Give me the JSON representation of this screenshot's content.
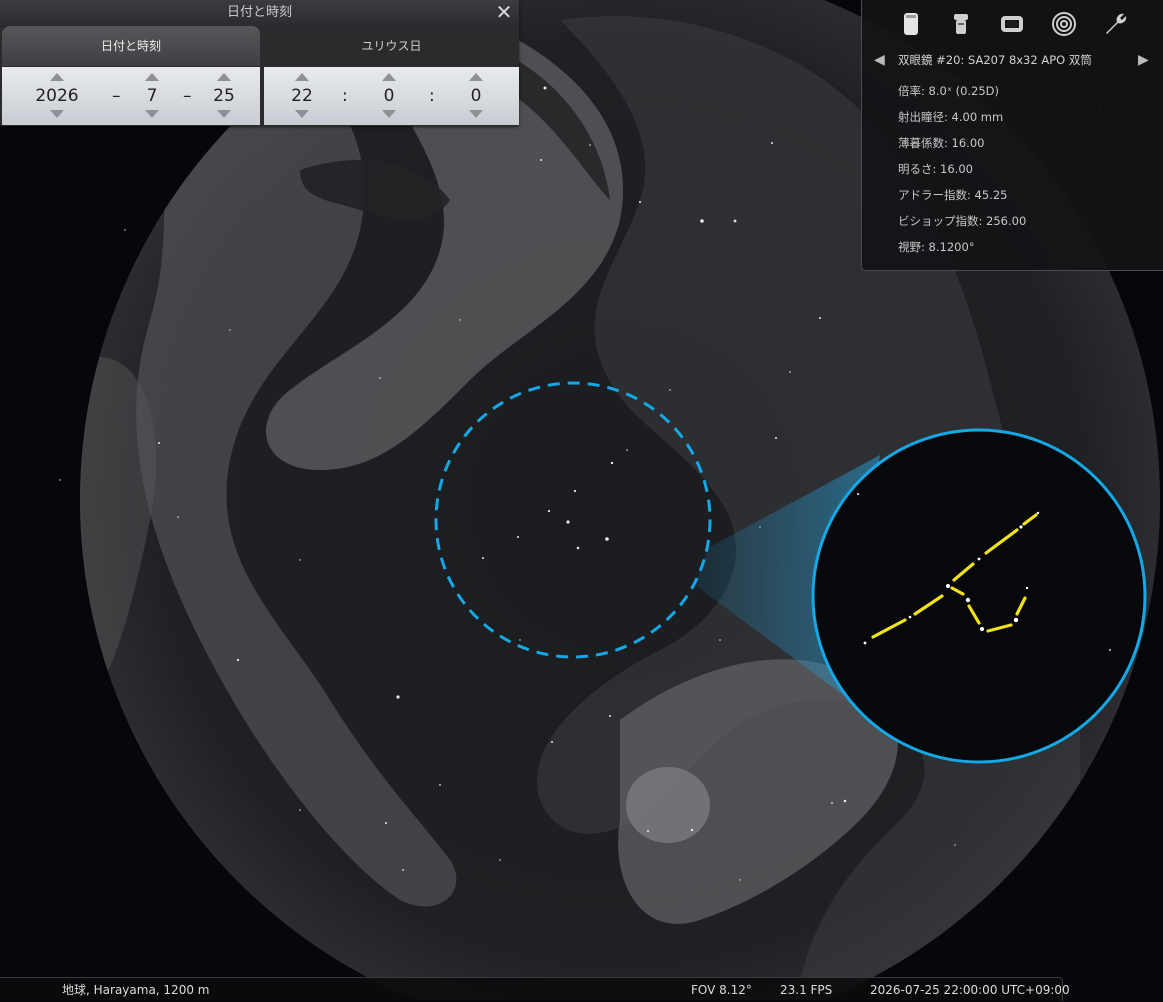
{
  "datetime_dialog": {
    "title": "日付と時刻",
    "close_symbol": "✕",
    "tabs": [
      {
        "label": "日付と時刻",
        "active": true
      },
      {
        "label": "ユリウス日",
        "active": false
      }
    ],
    "date": {
      "year": "2026",
      "month": "7",
      "day": "25",
      "separator": "–"
    },
    "time": {
      "hour": "22",
      "minute": "0",
      "second": "0",
      "separator": ":"
    }
  },
  "oculars_panel": {
    "icons": [
      "ocular-icon",
      "eyepiece-icon",
      "ccd-sensor-icon",
      "telrad-icon",
      "settings-wrench-icon"
    ],
    "prev_symbol": "◀",
    "next_symbol": "▶",
    "binocular_title": "双眼鏡 #20: SA207 8x32 APO 双筒",
    "rows": [
      "倍率: 8.0ˣ (0.25D)",
      "射出瞳径: 4.00 mm",
      "薄暮係数: 16.00",
      "明るさ: 16.00",
      "アドラー指数: 45.25",
      "ビショップ指数: 256.00",
      "視野: 8.1200°"
    ]
  },
  "status_bar": {
    "location": "地球, Harayama, 1200 m",
    "fov": "FOV 8.12°",
    "fps": "23.1 FPS",
    "datetime": "2026-07-25 22:00:00 UTC+09:00"
  },
  "colors": {
    "reticle_blue": "#14a8e6",
    "constellation_line": "#f2e21a",
    "sky": "#06070a",
    "milky_way": "#3a3b3e"
  }
}
